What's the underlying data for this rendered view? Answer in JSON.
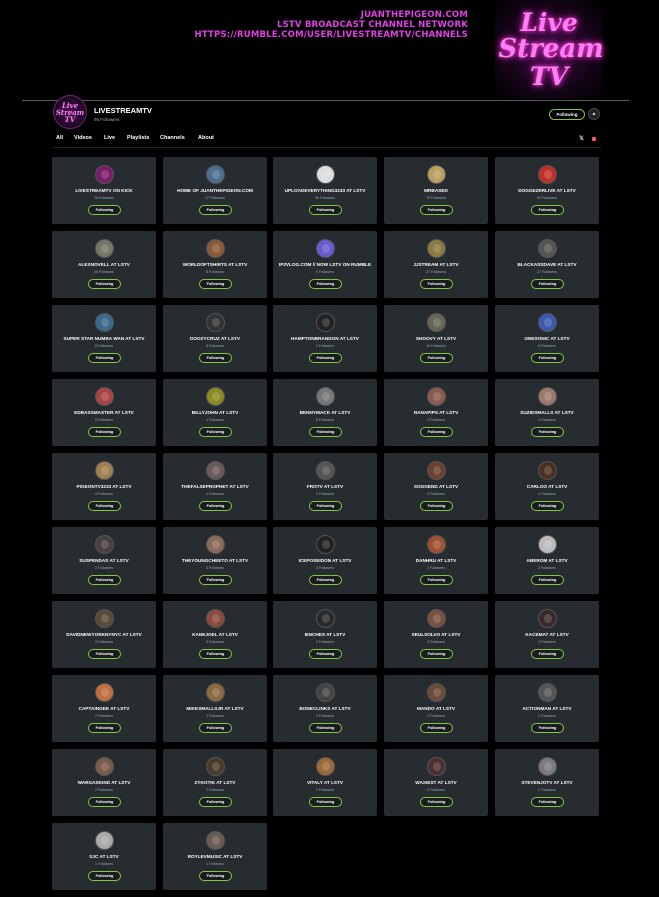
{
  "banner": {
    "lines": [
      "JUANTHEPIGEON.COM",
      "LSTV BROADCAST CHANNEL NETWORK",
      "HTTPS://RUMBLE.COM/USER/LIVESTREAMTV/CHANNELS"
    ],
    "logo_line1": "Live",
    "logo_line2": "Stream",
    "logo_line3": "TV"
  },
  "channel": {
    "avatar_text": "Live Stream TV",
    "name": "LIVESTREAMTV",
    "followers": "95 Followers",
    "following_label": "Following",
    "bell_icon": "bell-icon"
  },
  "tabs": [
    {
      "label": "All",
      "active": false
    },
    {
      "label": "Videos",
      "active": false
    },
    {
      "label": "Live",
      "active": false
    },
    {
      "label": "Playlists",
      "active": false
    },
    {
      "label": "Channels",
      "active": true
    },
    {
      "label": "About",
      "active": false
    }
  ],
  "social": {
    "x_icon": "x-icon",
    "x_glyph": "𝕏",
    "rss_icon": "rss-icon"
  },
  "colors": {
    "accent": "#85c742",
    "banner_text": "#e13ee6",
    "card_bg": "#272c31"
  },
  "follow_button_label": "Following",
  "cards": [
    {
      "name": "LIVESTREAMTV ON KICK",
      "followers": "26 Followers",
      "color": "#7a1d6b"
    },
    {
      "name": "HOME OF JUANTHEPIGEON.COM",
      "followers": "17 Followers",
      "color": "#4a6f8f"
    },
    {
      "name": "UPLOADEVERYTHING3233 AT LSTV",
      "followers": "56 Followers",
      "color": "#ddd"
    },
    {
      "name": "MRBASED",
      "followers": "76 Followers",
      "color": "#b8a060"
    },
    {
      "name": "DOGGEZERLIVE AT LSTV",
      "followers": "62 Followers",
      "color": "#c0302a"
    },
    {
      "name": "ALEXNOVELL AT LSTV",
      "followers": "26 Followers",
      "color": "#776"
    },
    {
      "name": "WORLDOFTSHIRTS AT LSTV",
      "followers": "8 Followers",
      "color": "#8a5a3a"
    },
    {
      "name": "IP2VLOG.COM // NOW LSTV ON RUMBLE",
      "followers": "9 Followers",
      "color": "#6a5ad0"
    },
    {
      "name": "JJSTREAM AT LSTV",
      "followers": "27 Followers",
      "color": "#8a7a40"
    },
    {
      "name": "BLACKASSDAVE AT LSTV",
      "followers": "27 Followers",
      "color": "#555"
    },
    {
      "name": "SUPER STAR NUMBA WAN AT LSTV",
      "followers": "8 Followers",
      "color": "#3a6a8a"
    },
    {
      "name": "DOOZYCRUZ AT LSTV",
      "followers": "8 Followers",
      "color": "#333"
    },
    {
      "name": "HAMPTONBRANDON AT LSTV",
      "followers": "4 Followers",
      "color": "#222"
    },
    {
      "name": "SHOOVY AT LSTV",
      "followers": "10 Followers",
      "color": "#665"
    },
    {
      "name": "ONESONIC AT LSTV",
      "followers": "5 Followers",
      "color": "#3a5ab0"
    },
    {
      "name": "EDBASSMASTER AT LSTV",
      "followers": "5 Followers",
      "color": "#a44"
    },
    {
      "name": "BILLYJOHN AT LSTV",
      "followers": "4 Followers",
      "color": "#8a8a20"
    },
    {
      "name": "BENNYMACK AT LSTV",
      "followers": "8 Followers",
      "color": "#777"
    },
    {
      "name": "NANAPIPS AT LSTV",
      "followers": "4 Followers",
      "color": "#8a5a50"
    },
    {
      "name": "SUZIESMALLS AT LSTV",
      "followers": "4 Followers",
      "color": "#9a7a6a"
    },
    {
      "name": "PIGEONTV3233 AT LSTV",
      "followers": "4 Followers",
      "color": "#a08050"
    },
    {
      "name": "THEFALSEPROPHET AT LSTV",
      "followers": "4 Followers",
      "color": "#6a5a5a"
    },
    {
      "name": "FROTV AT LSTV",
      "followers": "3 Followers",
      "color": "#555"
    },
    {
      "name": "SOGGEND AT LSTV",
      "followers": "3 Followers",
      "color": "#6a4030"
    },
    {
      "name": "CARLOO AT LSTV",
      "followers": "4 Followers",
      "color": "#4a3020"
    },
    {
      "name": "SUSPENDAS AT LSTV",
      "followers": "3 Followers",
      "color": "#4a4040"
    },
    {
      "name": "THEYOUNGCHEETO AT LSTV",
      "followers": "3 Followers",
      "color": "#8a6a5a"
    },
    {
      "name": "ICEPOSEIDON AT LSTV",
      "followers": "3 Followers",
      "color": "#222"
    },
    {
      "name": "DANHRU AT LSTV",
      "followers": "3 Followers",
      "color": "#a05030"
    },
    {
      "name": "ABEROM AT LSTV",
      "followers": "3 Followers",
      "color": "#bbb"
    },
    {
      "name": "DAVIDNEWYORKNYNYC AT LSTV",
      "followers": "3 Followers",
      "color": "#5a4a3a"
    },
    {
      "name": "KANEJOEL AT LSTV",
      "followers": "3 Followers",
      "color": "#8a4a40"
    },
    {
      "name": "8INCHES AT LSTV",
      "followers": "3 Followers",
      "color": "#2a2a2a"
    },
    {
      "name": "SEULSOLVO AT LSTV",
      "followers": "3 Followers",
      "color": "#7a5040"
    },
    {
      "name": "KACEMAT AT LSTV",
      "followers": "3 Followers",
      "color": "#3a2a2a"
    },
    {
      "name": "CAPTAINGEE AT LSTV",
      "followers": "2 Followers",
      "color": "#c07040"
    },
    {
      "name": "MIKESMALLSJR AT LSTV",
      "followers": "2 Followers",
      "color": "#8a6a40"
    },
    {
      "name": "BONECLINKS AT LSTV",
      "followers": "2 Followers",
      "color": "#444"
    },
    {
      "name": "MANDO AT LSTV",
      "followers": "2 Followers",
      "color": "#6a4a3a"
    },
    {
      "name": "ACTIONMAN AT LSTV",
      "followers": "2 Followers",
      "color": "#555"
    },
    {
      "name": "WARGASKIND AT LSTV",
      "followers": "2 Followers",
      "color": "#7a5a4a"
    },
    {
      "name": "ZYKOTIK AT LSTV",
      "followers": "2 Followers",
      "color": "#4a3a2a"
    },
    {
      "name": "VITALY AT LSTV",
      "followers": "2 Followers",
      "color": "#9a6a3a"
    },
    {
      "name": "WAXIEST AT LSTV",
      "followers": "2 Followers",
      "color": "#4a3030"
    },
    {
      "name": "STEVENJOTV AT LSTV",
      "followers": "2 Followers",
      "color": "#7a7a80"
    },
    {
      "name": "SJC AT LSTV",
      "followers": "1 Followers",
      "color": "#aaa"
    },
    {
      "name": "ROYLEVMUSIC AT LSTV",
      "followers": "1 Followers",
      "color": "#6a5a50"
    }
  ]
}
